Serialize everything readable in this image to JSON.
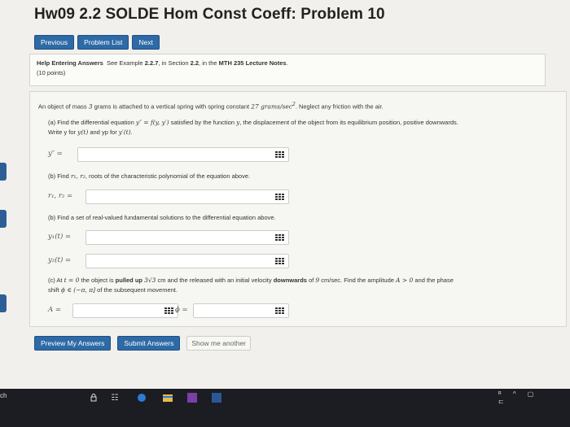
{
  "header": {
    "title": "Hw09 2.2 SOLDE Hom Const Coeff: Problem 10"
  },
  "nav": {
    "previous": "Previous",
    "problem_list": "Problem List",
    "next": "Next"
  },
  "help": {
    "link": "Help Entering Answers",
    "see_text": "See Example",
    "example": "2.2.7",
    "in_section": ", in Section",
    "section": "2.2",
    "in_the": ", in the",
    "notes": "MTH 235 Lecture Notes",
    "period": ".",
    "points": "(10 points)"
  },
  "problem": {
    "intro_a": "An object of mass",
    "mass": "3",
    "intro_b": "grams is attached to a vertical spring with spring constant",
    "spring_const": "27 grams/sec",
    "exp": "2",
    "intro_c": ". Neglect any friction with the air.",
    "part_a_1": "(a) Find the differential equation",
    "part_a_eq": "y″ = f(y, y′)",
    "part_a_2": "satisfied by the function",
    "part_a_y": "y",
    "part_a_3": ", the displacement of the object from its equilibrium position, positive downwards.",
    "part_a_line2a": "Write y for",
    "part_a_yt": "y(t)",
    "part_a_line2b": "and yp for",
    "part_a_ypt": "y′(t)",
    "part_a_line2c": ".",
    "label_ypp": "y″ =",
    "part_b1_a": "(b) Find",
    "part_b1_r": "r₁, r₂",
    "part_b1_b": ", roots of the characteristic polynomial of the equation above.",
    "label_r": "r₁, r₂ =",
    "part_b2": "(b) Find a set of real-valued fundamental solutions to the differential equation above.",
    "label_y1": "y₁(t) =",
    "label_y2": "y₂(t) =",
    "part_c_a": "(c) At",
    "part_c_t": "t = 0",
    "part_c_b": "the object is",
    "part_c_pulled": "pulled up",
    "part_c_dist": "3√3",
    "part_c_c": "cm and the released with an initial velocity",
    "part_c_down": "downwards",
    "part_c_d": "of",
    "part_c_v": "9",
    "part_c_e": "cm/sec. Find the amplitude",
    "part_c_A": "A > 0",
    "part_c_f": "and the phase",
    "part_c_line2a": "shift",
    "part_c_phi": "ϕ ∈ (−π, π]",
    "part_c_line2b": "of the subsequent movement.",
    "label_A": "A =",
    "label_phi": "ϕ ="
  },
  "footer": {
    "preview": "Preview My Answers",
    "submit": "Submit Answers",
    "show_another": "Show me another"
  },
  "taskbar": {
    "search_stub": "ch",
    "taskview": "☷",
    "system": "ᴿ ^ ▢ ⊏"
  },
  "colors": {
    "primary_button": "#2d6aa6",
    "taskbar": "#1b1d22"
  }
}
